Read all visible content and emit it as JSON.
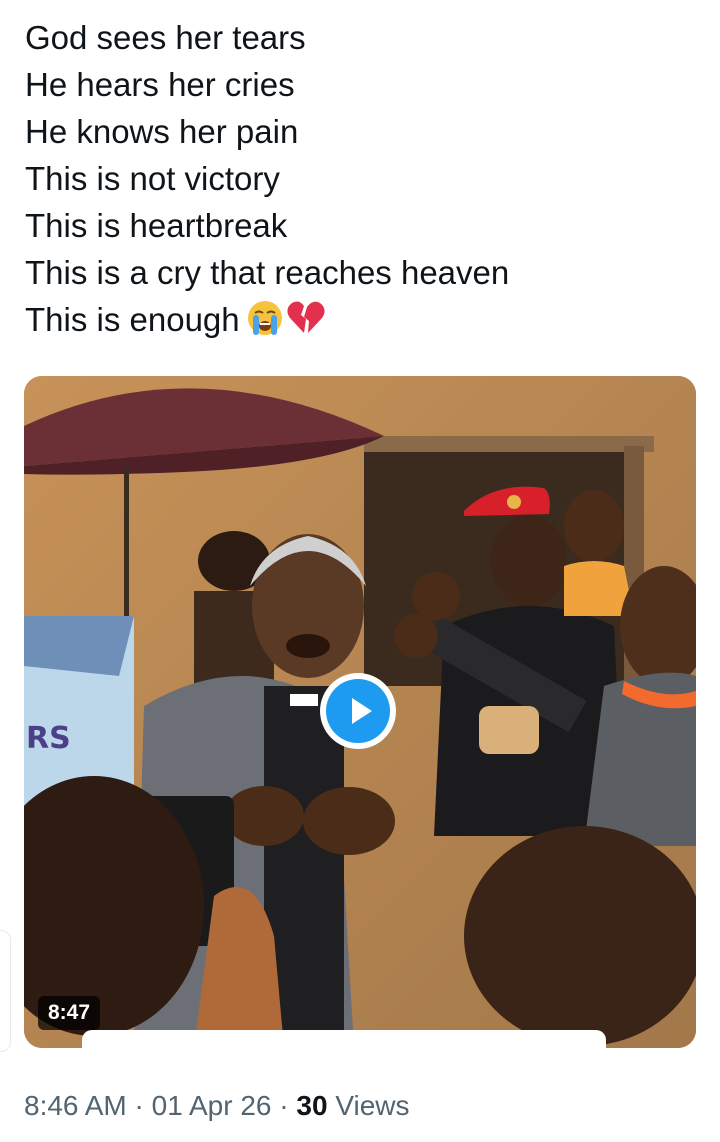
{
  "tweet": {
    "lines": [
      "God sees her tears",
      "He hears her cries",
      "He knows her pain",
      "This is not victory",
      "This is heartbreak",
      "This is a cry that reaches heaven",
      "This is enough"
    ],
    "emojis": [
      "loudly-crying-face",
      "broken-heart"
    ]
  },
  "media": {
    "duration": "8:47",
    "jersey_text": "RS",
    "colors": {
      "play_button": "#1d9bf0",
      "beret": "#d8202b",
      "umbrella": "#6b2f36"
    }
  },
  "meta": {
    "time": "8:46 AM",
    "date": "01 Apr 26",
    "views_count": "30",
    "views_label": "Views",
    "separator": "·"
  }
}
